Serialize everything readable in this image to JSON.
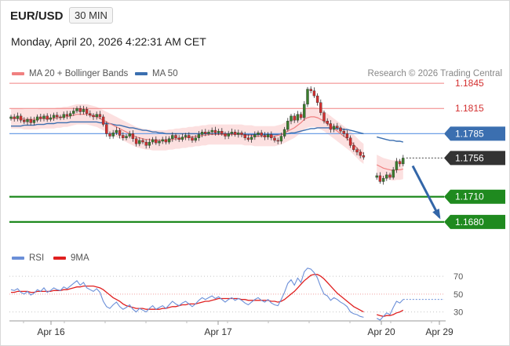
{
  "header": {
    "symbol": "EUR/USD",
    "timeframe": "30 MIN",
    "datetime": "Monday, April 20, 2026 4:22:31 AM CET",
    "copyright": "Research © 2026 Trading Central"
  },
  "legend": {
    "ma20_label": "MA 20 + Bollinger Bands",
    "ma50_label": "MA 50",
    "rsi_label": "RSI",
    "ma9_label": "9MA"
  },
  "colors": {
    "candle_up": "#3a7d2c",
    "candle_down": "#d32f2f",
    "ma20": "#f08080",
    "ma50": "#3b6fb0",
    "bollinger_fill": "#fbd5d5",
    "resistance": "#f08080",
    "pivot": "#6fa0e6",
    "support": "#1f8a1f",
    "current": "#333333",
    "arrow": "#3366a8",
    "rsi": "#6b8fd8",
    "rsi_ma": "#e02020"
  },
  "chart_data": [
    {
      "type": "candlestick",
      "title": "EUR/USD 30 MIN",
      "x_tick_labels": [
        "Apr 16",
        "Apr 17",
        "Apr 20",
        "Apr 29"
      ],
      "ylim": [
        1.165,
        1.186
      ],
      "levels": [
        {
          "label": "1.1845",
          "value": 1.1845,
          "kind": "resistance"
        },
        {
          "label": "1.1815",
          "value": 1.1815,
          "kind": "resistance"
        },
        {
          "label": "1.1785",
          "value": 1.1785,
          "kind": "pivot"
        },
        {
          "label": "1.1756",
          "value": 1.1756,
          "kind": "current"
        },
        {
          "label": "1.1710",
          "value": 1.171,
          "kind": "support"
        },
        {
          "label": "1.1680",
          "value": 1.168,
          "kind": "support"
        }
      ],
      "forecast_arrow": {
        "from": 1.1756,
        "to": 1.168
      },
      "close_series": [
        1.1805,
        1.1803,
        1.1806,
        1.1801,
        1.1799,
        1.1802,
        1.1798,
        1.1801,
        1.1805,
        1.1803,
        1.1806,
        1.1802,
        1.1804,
        1.1807,
        1.1805,
        1.1804,
        1.1808,
        1.1806,
        1.1809,
        1.1812,
        1.1815,
        1.1811,
        1.1814,
        1.1809,
        1.1807,
        1.1805,
        1.1808,
        1.1805,
        1.1796,
        1.1785,
        1.1782,
        1.1786,
        1.1789,
        1.1783,
        1.178,
        1.1782,
        1.1785,
        1.1779,
        1.1773,
        1.1777,
        1.1775,
        1.1771,
        1.1775,
        1.1778,
        1.1774,
        1.1776,
        1.1778,
        1.1775,
        1.1779,
        1.1783,
        1.178,
        1.1778,
        1.1781,
        1.1783,
        1.178,
        1.1777,
        1.178,
        1.1784,
        1.1787,
        1.1785,
        1.1787,
        1.1789,
        1.1786,
        1.1788,
        1.1785,
        1.1782,
        1.1785,
        1.1787,
        1.1784,
        1.1786,
        1.1784,
        1.178,
        1.1778,
        1.1781,
        1.1784,
        1.1786,
        1.1783,
        1.1781,
        1.1784,
        1.178,
        1.1777,
        1.1776,
        1.1782,
        1.179,
        1.18,
        1.1806,
        1.1801,
        1.1808,
        1.1804,
        1.182,
        1.1838,
        1.1836,
        1.183,
        1.1822,
        1.181,
        1.18,
        1.1797,
        1.179,
        1.1794,
        1.1792,
        1.1788,
        1.1785,
        1.178,
        1.1771,
        1.1766,
        1.1763,
        1.1759,
        1.1757,
        null,
        null,
        null,
        1.1735,
        1.1728,
        1.1732,
        1.1736,
        1.1733,
        1.1742,
        1.1752,
        1.1749,
        1.1756
      ],
      "ma20": [
        1.1803,
        1.1803,
        1.1803,
        1.1803,
        1.1802,
        1.1802,
        1.1802,
        1.1802,
        1.1802,
        1.1803,
        1.1803,
        1.1803,
        1.1803,
        1.1803,
        1.1804,
        1.1804,
        1.1805,
        1.1805,
        1.1806,
        1.1807,
        1.1808,
        1.1808,
        1.1808,
        1.1808,
        1.1807,
        1.1806,
        1.1805,
        1.1803,
        1.1801,
        1.1799,
        1.1797,
        1.1795,
        1.1793,
        1.1791,
        1.1789,
        1.1787,
        1.1785,
        1.1783,
        1.1781,
        1.178,
        1.1779,
        1.1778,
        1.1778,
        1.1777,
        1.1777,
        1.1777,
        1.1777,
        1.1777,
        1.1778,
        1.1778,
        1.1779,
        1.1779,
        1.178,
        1.178,
        1.1781,
        1.1781,
        1.1782,
        1.1782,
        1.1783,
        1.1783,
        1.1784,
        1.1784,
        1.1784,
        1.1784,
        1.1784,
        1.1784,
        1.1784,
        1.1784,
        1.1784,
        1.1784,
        1.1784,
        1.1783,
        1.1783,
        1.1783,
        1.1782,
        1.1782,
        1.1782,
        1.1782,
        1.1782,
        1.1782,
        1.1782,
        1.1783,
        1.1784,
        1.1786,
        1.1788,
        1.179,
        1.1792,
        1.1795,
        1.1798,
        1.1802,
        1.1804,
        1.1805,
        1.1805,
        1.1804,
        1.1802,
        1.18,
        1.1797,
        1.1794,
        1.1791,
        1.1788,
        1.1785,
        1.1782,
        1.1779,
        1.1776,
        1.1772,
        1.1768,
        1.1764,
        1.1761,
        null,
        null,
        null,
        1.1748,
        1.1746,
        1.1744,
        1.1743,
        1.1742,
        1.1741,
        1.1742,
        1.1742,
        1.1743
      ],
      "ma50": [
        1.1794,
        1.1794,
        1.1794,
        1.1794,
        1.1795,
        1.1795,
        1.1795,
        1.1795,
        1.1796,
        1.1796,
        1.1796,
        1.1797,
        1.1797,
        1.1797,
        1.1798,
        1.1798,
        1.1798,
        1.1798,
        1.1799,
        1.1799,
        1.1799,
        1.1799,
        1.1799,
        1.1799,
        1.1799,
        1.1799,
        1.1799,
        1.1798,
        1.1798,
        1.1797,
        1.1797,
        1.1796,
        1.1795,
        1.1795,
        1.1794,
        1.1793,
        1.1792,
        1.1792,
        1.1791,
        1.179,
        1.1789,
        1.1789,
        1.1788,
        1.1787,
        1.1787,
        1.1786,
        1.1786,
        1.1785,
        1.1785,
        1.1785,
        1.1785,
        1.1785,
        1.1785,
        1.1785,
        1.1785,
        1.1785,
        1.1785,
        1.1785,
        1.1785,
        1.1785,
        1.1785,
        1.1785,
        1.1785,
        1.1785,
        1.1785,
        1.1785,
        1.1785,
        1.1785,
        1.1785,
        1.1784,
        1.1784,
        1.1784,
        1.1784,
        1.1784,
        1.1784,
        1.1784,
        1.1784,
        1.1784,
        1.1784,
        1.1784,
        1.1784,
        1.1784,
        1.1784,
        1.1785,
        1.1785,
        1.1786,
        1.1786,
        1.1787,
        1.1788,
        1.1789,
        1.179,
        1.1791,
        1.1791,
        1.1792,
        1.1792,
        1.1792,
        1.1792,
        1.1792,
        1.1792,
        1.1791,
        1.1791,
        1.179,
        1.179,
        1.1789,
        1.1788,
        1.1787,
        1.1786,
        1.1785,
        null,
        null,
        null,
        1.1781,
        1.178,
        1.1779,
        1.1778,
        1.1777,
        1.1777,
        1.1776,
        1.1776,
        1.1775
      ]
    },
    {
      "type": "line",
      "title": "RSI",
      "y_tick_labels": [
        "70",
        "50",
        "30"
      ],
      "ylim": [
        20,
        85
      ],
      "series": [
        {
          "name": "RSI",
          "values": [
            55,
            54,
            56,
            52,
            50,
            53,
            49,
            51,
            55,
            53,
            57,
            52,
            54,
            57,
            55,
            54,
            58,
            56,
            59,
            62,
            65,
            60,
            63,
            57,
            55,
            53,
            56,
            52,
            42,
            36,
            34,
            38,
            41,
            36,
            33,
            35,
            38,
            33,
            30,
            34,
            32,
            30,
            34,
            37,
            33,
            35,
            37,
            34,
            38,
            42,
            39,
            37,
            40,
            42,
            39,
            36,
            39,
            43,
            46,
            44,
            46,
            48,
            45,
            47,
            44,
            41,
            44,
            46,
            43,
            45,
            43,
            40,
            38,
            41,
            44,
            46,
            43,
            41,
            44,
            40,
            38,
            37,
            44,
            52,
            62,
            66,
            60,
            68,
            63,
            75,
            79,
            78,
            74,
            68,
            58,
            50,
            48,
            43,
            46,
            44,
            41,
            39,
            36,
            30,
            28,
            27,
            25,
            24,
            null,
            null,
            null,
            23,
            21,
            25,
            29,
            27,
            35,
            42,
            40,
            44
          ]
        },
        {
          "name": "9MA",
          "values": [
            52,
            52,
            53,
            53,
            53,
            53,
            52,
            52,
            53,
            53,
            53,
            53,
            53,
            54,
            54,
            54,
            55,
            55,
            56,
            57,
            58,
            58,
            59,
            59,
            59,
            59,
            58,
            57,
            55,
            52,
            49,
            46,
            44,
            42,
            39,
            37,
            36,
            35,
            34,
            34,
            34,
            33,
            33,
            33,
            33,
            33,
            34,
            34,
            35,
            36,
            36,
            37,
            38,
            38,
            39,
            39,
            39,
            40,
            41,
            42,
            42,
            43,
            44,
            45,
            45,
            45,
            45,
            45,
            45,
            45,
            44,
            44,
            43,
            43,
            43,
            43,
            43,
            43,
            43,
            42,
            42,
            41,
            42,
            44,
            47,
            50,
            53,
            57,
            61,
            65,
            68,
            71,
            72,
            72,
            70,
            67,
            63,
            59,
            55,
            51,
            48,
            45,
            42,
            39,
            36,
            34,
            32,
            30,
            null,
            null,
            null,
            27,
            26,
            25,
            26,
            26,
            27,
            29,
            30,
            32
          ]
        }
      ]
    }
  ]
}
